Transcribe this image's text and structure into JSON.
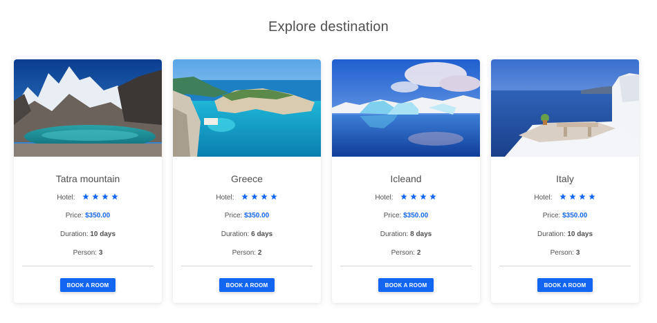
{
  "page": {
    "title": "Explore destination"
  },
  "labels": {
    "hotel": "Hotel:",
    "price": "Price:",
    "duration": "Duration:",
    "person": "Person:",
    "book": "BOOK A ROOM"
  },
  "colors": {
    "accent": "#1266f1",
    "text": "#4f4f4f",
    "star": "#1266f1"
  },
  "cards": [
    {
      "title": "Tatra mountain",
      "hotel_stars": 4,
      "price": "$350.00",
      "duration": "10 days",
      "person": "3",
      "image": "mountain-lake-photo"
    },
    {
      "title": "Greece",
      "hotel_stars": 4,
      "price": "$350.00",
      "duration": "6 days",
      "person": "2",
      "image": "turquoise-bay-photo"
    },
    {
      "title": "Icleand",
      "hotel_stars": 4,
      "price": "$350.00",
      "duration": "8 days",
      "person": "2",
      "image": "glacier-lagoon-photo"
    },
    {
      "title": "Italy",
      "hotel_stars": 4,
      "price": "$350.00",
      "duration": "10 days",
      "person": "3",
      "image": "sea-terrace-photo"
    }
  ]
}
